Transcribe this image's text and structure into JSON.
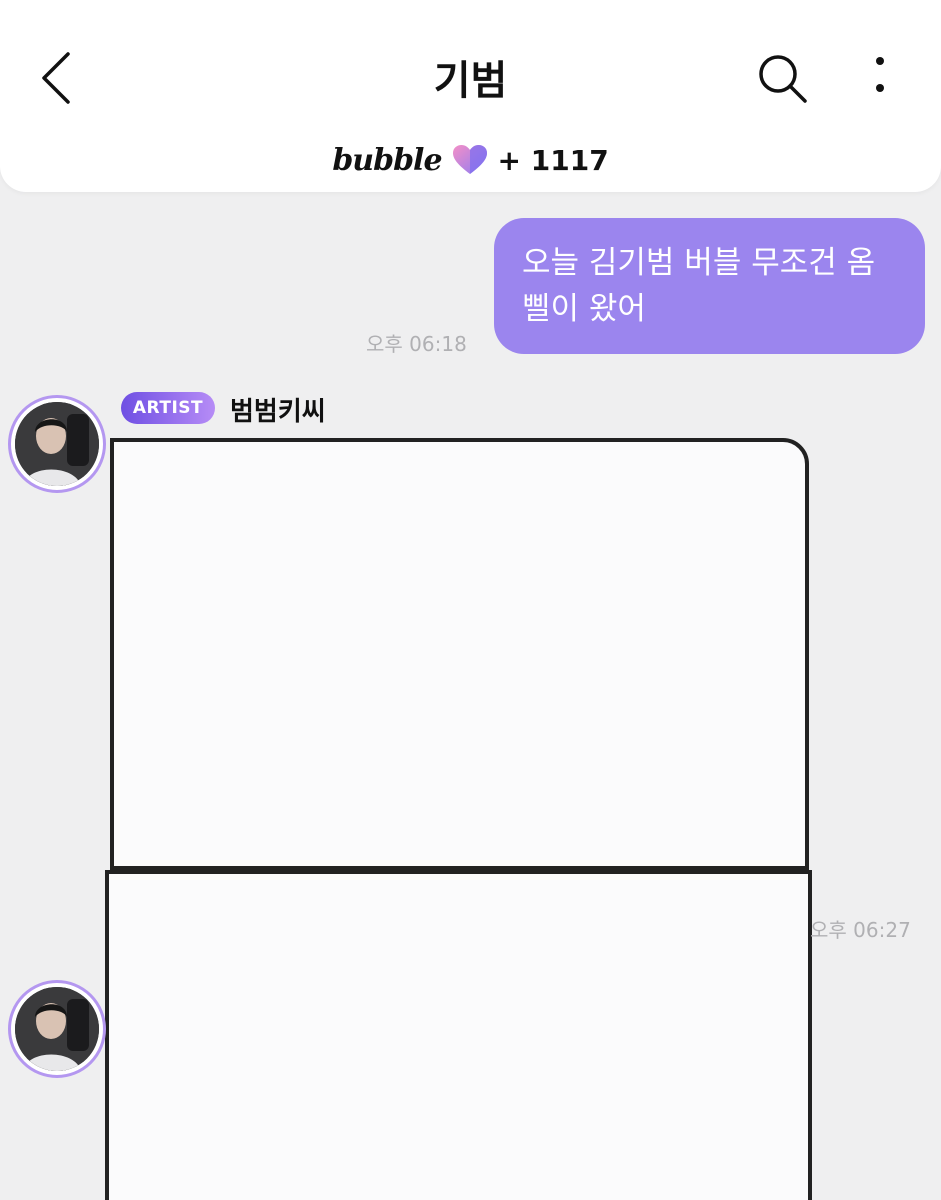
{
  "header": {
    "title": "기범",
    "brand": "bubble",
    "subscriber_count": "+ 1117",
    "icons": {
      "back": "back-chevron-icon",
      "search": "search-icon",
      "more": "more-vertical-icon",
      "heart": "heart-icon"
    }
  },
  "messages": [
    {
      "direction": "out",
      "lines": [
        "오늘 김기범 버블 무조건 옴",
        "삘이 왔어"
      ],
      "time": "오후 06:18"
    },
    {
      "direction": "in",
      "badge": "ARTIST",
      "sender": "범범키씨",
      "type": "image",
      "time": "오후 06:27"
    }
  ],
  "colors": {
    "accent": "#9b85ee",
    "badge_start": "#6f4fe3",
    "badge_end": "#b68cf6",
    "background": "#efeff0"
  }
}
